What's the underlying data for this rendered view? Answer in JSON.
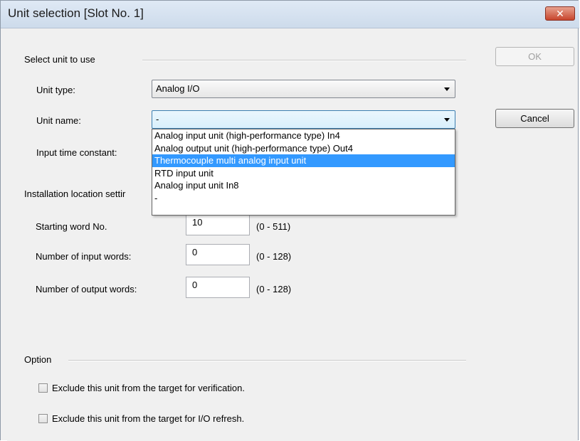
{
  "window": {
    "title": "Unit selection [Slot No. 1]",
    "close_symbol": "✕"
  },
  "select_unit": {
    "section_label": "Select unit to use",
    "unit_type_label": "Unit type:",
    "unit_type_value": "Analog I/O",
    "unit_name_label": "Unit name:",
    "unit_name_value": "-",
    "input_time_constant_label": "Input time constant:",
    "dropdown_options": [
      "Analog input unit (high-performance type) In4",
      "Analog output unit (high-performance type) Out4",
      "Thermocouple multi analog input unit",
      "RTD input unit",
      "Analog input unit  In8",
      "-"
    ],
    "highlighted_option": "Thermocouple multi analog input unit"
  },
  "buttons": {
    "ok": "OK",
    "cancel": "Cancel"
  },
  "installation": {
    "section_label": "Installation location settir",
    "starting_word_label": "Starting word No.",
    "starting_word_value": "10",
    "starting_word_range": "(0 - 511)",
    "input_words_label": "Number of input words:",
    "input_words_value": "0",
    "input_words_range": "(0 - 128)",
    "output_words_label": "Number of output words:",
    "output_words_value": "0",
    "output_words_range": "(0 - 128)"
  },
  "option": {
    "section_label": "Option",
    "exclude_verification": "Exclude this unit from the target for verification.",
    "exclude_io_refresh": "Exclude this unit from the target for I/O refresh."
  }
}
